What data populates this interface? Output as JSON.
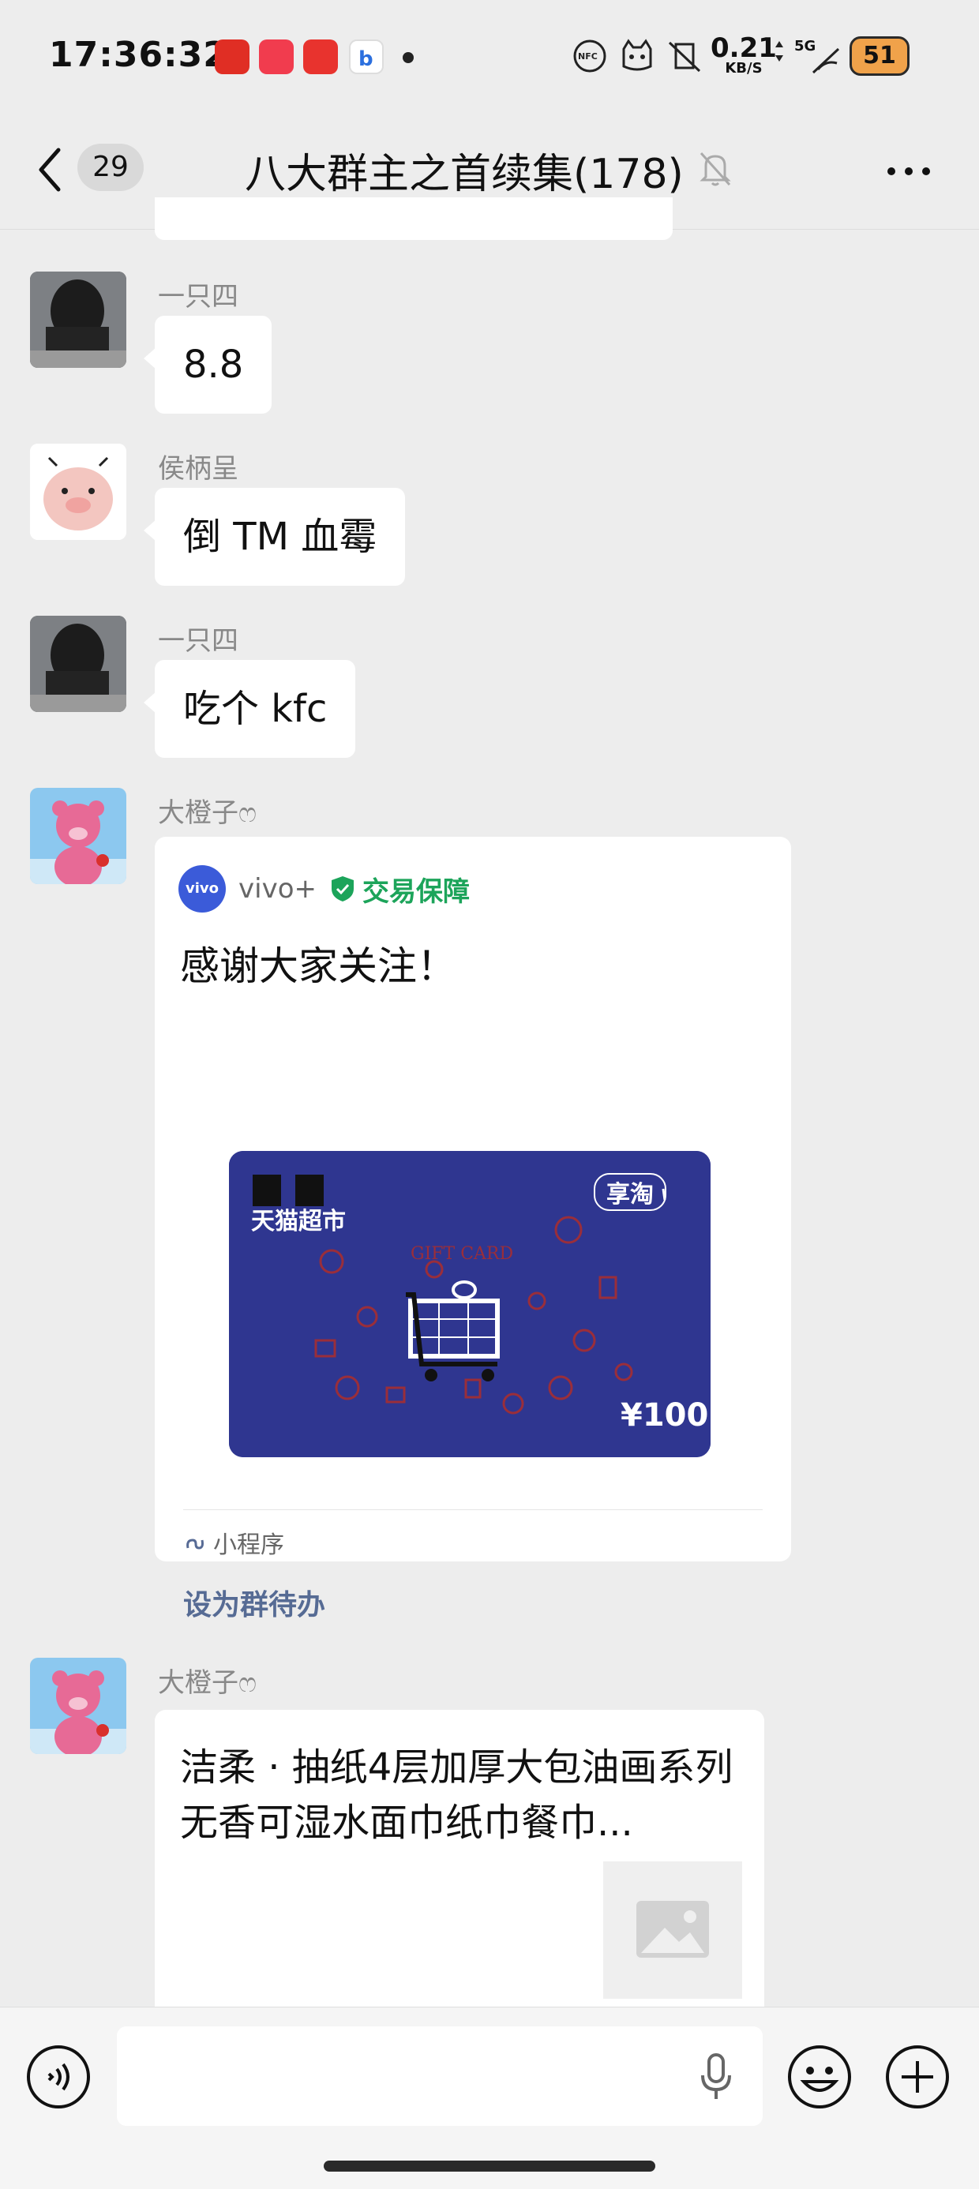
{
  "status_bar": {
    "time": "17:36:32",
    "speed_value": "0.21",
    "speed_unit": "KB/S",
    "network": "5G",
    "battery": "51",
    "app_icons": [
      "pinduoduo-icon",
      "dianping-icon",
      "suning-icon",
      "baidu-map-icon"
    ],
    "status_icons": [
      "nfc-icon",
      "cat-icon",
      "vibrate-off-icon",
      "signal-icon"
    ]
  },
  "nav": {
    "unread_count": "29",
    "title": "八大群主之首续集(178)"
  },
  "messages": [
    {
      "sender": "一只四",
      "text": "8.8"
    },
    {
      "sender": "侯柄呈",
      "text": "倒 TM 血霉"
    },
    {
      "sender": "一只四",
      "text": "吃个 kfc"
    }
  ],
  "card_message": {
    "sender": "大橙子ෆ",
    "brand_logo": "vivo",
    "brand": "vivo+",
    "badge": "交易保障",
    "text": "感谢大家关注！",
    "giftcard": {
      "store": "天猫超市",
      "corner_logo": "享淘",
      "label": "GIFT CARD",
      "value": "¥100"
    },
    "source": "小程序",
    "action": "设为群待办"
  },
  "product_message": {
    "sender": "大橙子ෆ",
    "title": "洁柔 · 抽纸4层加厚大包油画系列无香可湿水面巾纸巾餐巾..."
  },
  "input_bar": {
    "placeholder": ""
  },
  "colors": {
    "background": "#ededed",
    "bubble": "#ffffff",
    "accent_green": "#1ca45a",
    "link_blue": "#566b94",
    "giftcard_blue": "#2f3690"
  }
}
